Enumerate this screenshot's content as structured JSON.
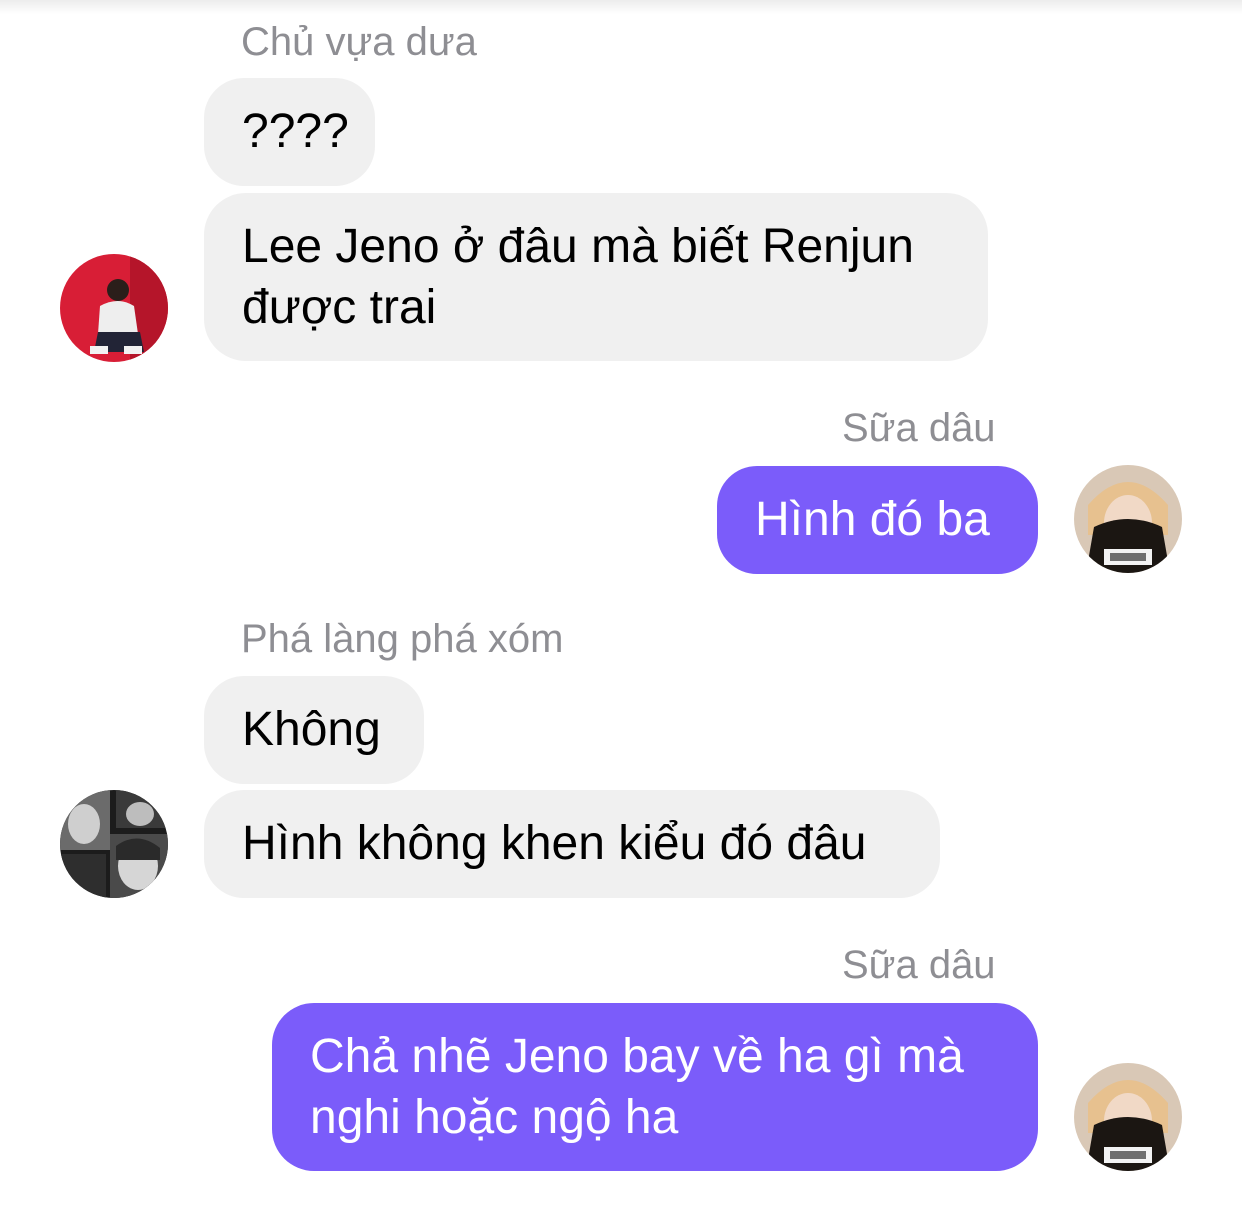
{
  "conversation": {
    "groups": [
      {
        "sender": "Chủ vựa dưa",
        "direction": "incoming",
        "messages": [
          "????",
          "Lee Jeno ở đâu mà biết Renjun\nđược trai"
        ],
        "avatar_icon": "red-background-person-avatar"
      },
      {
        "sender": "Sữa dâu",
        "direction": "outgoing",
        "messages": [
          "Hình đó ba"
        ],
        "avatar_icon": "blonde-person-mask-avatar"
      },
      {
        "sender": "Phá làng phá xóm",
        "direction": "incoming",
        "messages": [
          "Không",
          "Hình không khen kiểu đó đâu"
        ],
        "avatar_icon": "grayscale-collage-avatar"
      },
      {
        "sender": "Sữa dâu",
        "direction": "outgoing",
        "messages": [
          "Chả nhẽ Jeno bay về ha gì mà\nnghi hoặc ngộ ha"
        ],
        "avatar_icon": "blonde-person-mask-avatar"
      }
    ]
  },
  "colors": {
    "outgoing_bubble": "#7b5cfa",
    "incoming_bubble": "#f0f0f0",
    "sender_name": "#8e8e93"
  }
}
